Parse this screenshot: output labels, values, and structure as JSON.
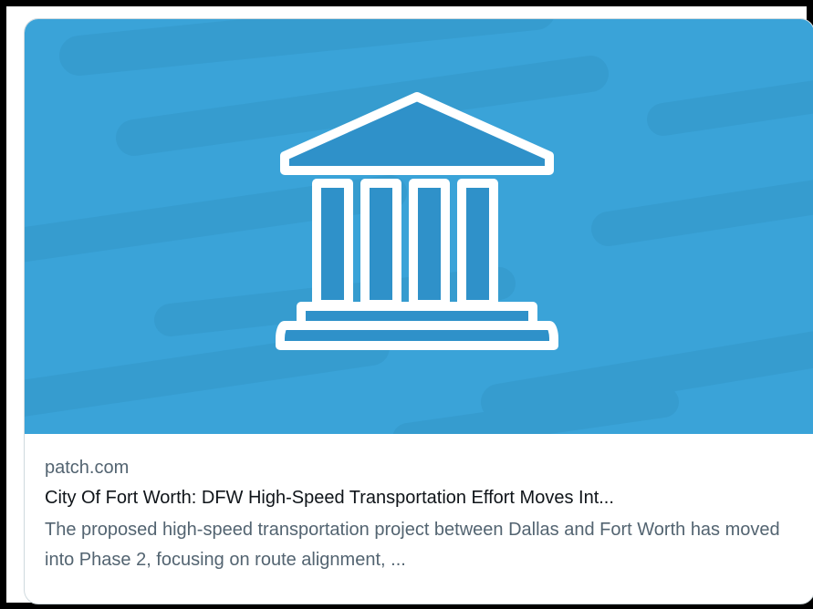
{
  "card": {
    "domain": "patch.com",
    "title": "City Of Fort Worth: DFW High-Speed Transportation Effort Moves Int...",
    "description": "The proposed high-speed transportation project between Dallas and Fort Worth has moved into Phase 2, focusing on route alignment, ...",
    "image": {
      "icon": "government-building-icon",
      "background_color": "#3aa3d8",
      "streak_color": "#369ccf",
      "icon_fill_color": "#2f91c9",
      "icon_outline_color": "#ffffff"
    }
  }
}
